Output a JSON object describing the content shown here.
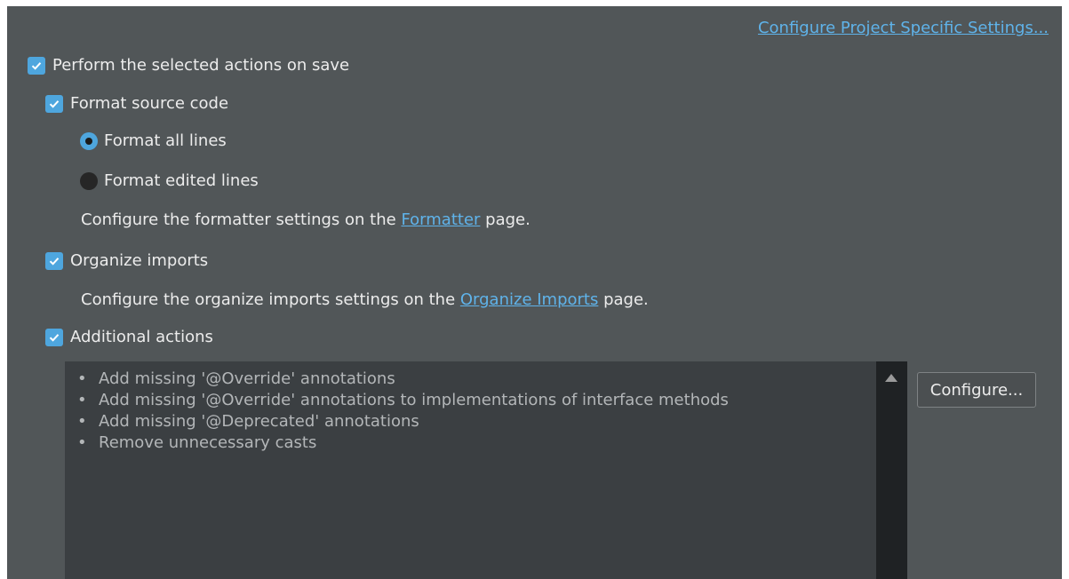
{
  "header": {
    "project_settings_link": "Configure Project Specific Settings..."
  },
  "save_actions": {
    "perform_on_save": {
      "label": "Perform the selected actions on save",
      "checked": true
    },
    "format_source": {
      "label": "Format source code",
      "checked": true
    },
    "format_all_lines": {
      "label": "Format all lines",
      "selected": true
    },
    "format_edited_lines": {
      "label": "Format edited lines",
      "selected": false
    },
    "formatter_hint": {
      "prefix": "Configure the formatter settings on the ",
      "link": "Formatter",
      "suffix": " page."
    },
    "organize_imports": {
      "label": "Organize imports",
      "checked": true
    },
    "organize_hint": {
      "prefix": "Configure the organize imports settings on the ",
      "link": "Organize Imports",
      "suffix": " page."
    },
    "additional_actions": {
      "label": "Additional actions",
      "checked": true
    },
    "actions_list": [
      "Add missing '@Override' annotations",
      "Add missing '@Override' annotations to implementations of interface methods",
      "Add missing '@Deprecated' annotations",
      "Remove unnecessary casts"
    ],
    "bullet": "•",
    "configure_button": "Configure..."
  },
  "colors": {
    "panel_bg": "#515658",
    "accent": "#4ea6de",
    "link": "#5fb3ea",
    "list_bg": "#3b3f42"
  },
  "icons": {
    "checkbox": "checkmark-icon",
    "scroll": "triangle-up-icon"
  }
}
